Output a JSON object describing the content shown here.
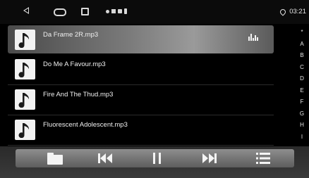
{
  "status_bar": {
    "time": "03:21"
  },
  "songs": [
    {
      "title": "Da Frame 2R.mp3",
      "active": true
    },
    {
      "title": "Do Me A Favour.mp3",
      "active": false
    },
    {
      "title": "Fire And The Thud.mp3",
      "active": false
    },
    {
      "title": "Fluorescent Adolescent.mp3",
      "active": false
    }
  ],
  "az_index": [
    "*",
    "A",
    "B",
    "C",
    "D",
    "E",
    "F",
    "G",
    "H",
    "I"
  ],
  "controls": {
    "folder": "folder-icon",
    "previous": "skip-previous-icon",
    "play_pause": "pause-icon",
    "next": "skip-next-icon",
    "playlist": "list-icon"
  },
  "colors": {
    "background": "#000000",
    "active_row": "#7a7a7a",
    "icon": "#f2f2f2"
  }
}
